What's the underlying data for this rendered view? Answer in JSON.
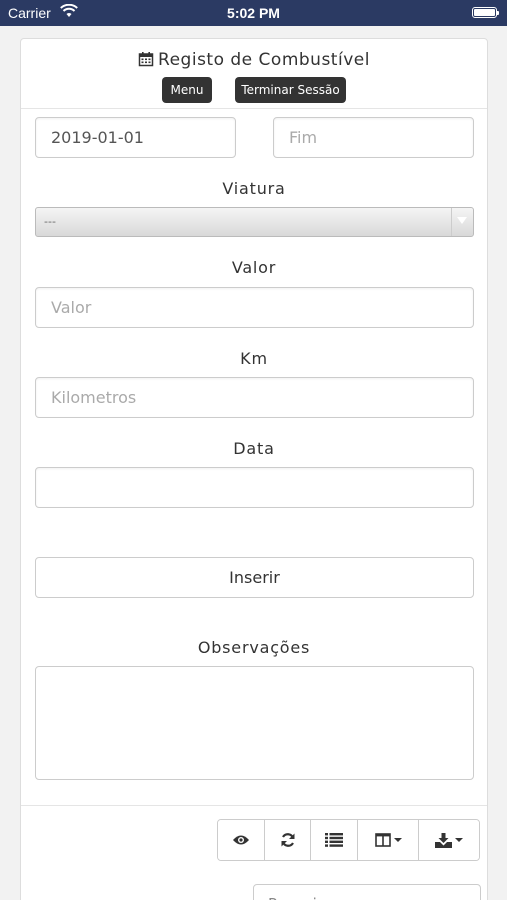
{
  "status_bar": {
    "carrier": "Carrier",
    "time": "5:02 PM",
    "icons": [
      "wifi-icon",
      "battery-icon"
    ]
  },
  "header": {
    "title": "Registo de Combustível",
    "title_icon": "calendar-icon",
    "menu_button": "Menu",
    "logout_button": "Terminar Sessão",
    "button_color": "#333333"
  },
  "form": {
    "start_date": {
      "value": "2019-01-01",
      "placeholder": ""
    },
    "end_date": {
      "value": "",
      "placeholder": "Fim"
    },
    "vehicle": {
      "label": "Viatura",
      "selected": "---"
    },
    "value": {
      "label": "Valor",
      "value": "",
      "placeholder": "Valor"
    },
    "km": {
      "label": "Km",
      "value": "",
      "placeholder": "Kilometros"
    },
    "date": {
      "label": "Data",
      "value": ""
    },
    "insert_button": "Inserir",
    "notes": {
      "label": "Observações",
      "value": ""
    }
  },
  "table_toolbar": {
    "buttons": [
      "eye-icon",
      "refresh-icon",
      "list-icon",
      "columns-icon",
      "download-icon"
    ]
  },
  "search": {
    "partial_text": "Pesquisar"
  }
}
